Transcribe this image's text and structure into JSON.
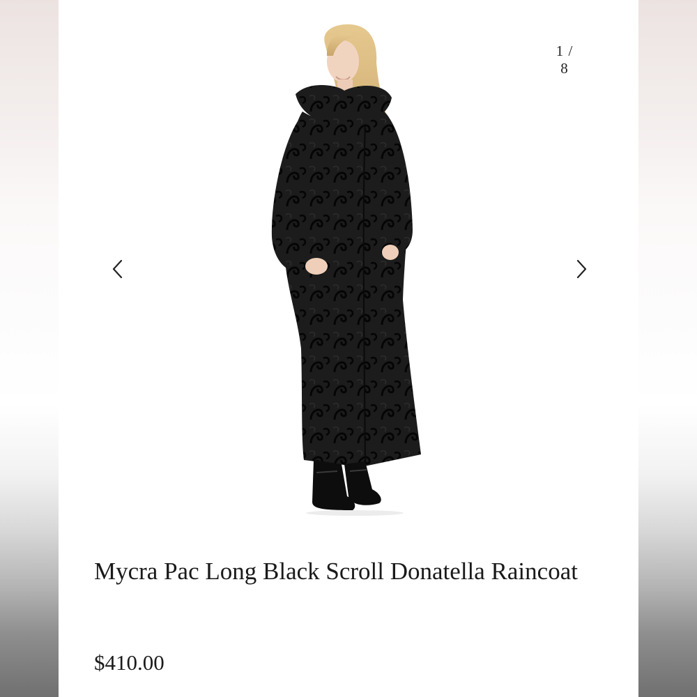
{
  "gallery": {
    "counter": "1 / 8",
    "prev_icon": "chevron-left-icon",
    "next_icon": "chevron-right-icon"
  },
  "product": {
    "title": "Mycra Pac Long Black Scroll Donatella Raincoat",
    "price": "$410.00"
  },
  "colors": {
    "text": "#1a1a1a",
    "background": "#ffffff",
    "coat": "#141414"
  }
}
